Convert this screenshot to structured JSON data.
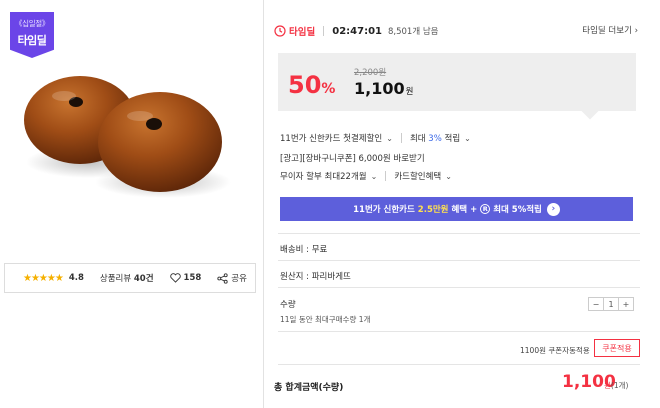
{
  "badge": {
    "top": "《십일절》",
    "main": "타임딜"
  },
  "rating": {
    "stars": "★★★★★",
    "score": "4.8",
    "review_label": "상품리뷰",
    "review_count": "40건",
    "likes": "158",
    "share_label": "공유"
  },
  "timedeal": {
    "label": "타임딜",
    "time": "02:47:01",
    "remaining": "8,501개 남음",
    "more": "타임딜 더보기"
  },
  "price": {
    "discount": "50",
    "pct": "%",
    "original": "2,200원",
    "sale": "1,100",
    "won": "원"
  },
  "benefits": {
    "card": "11번가 신한카드 첫결제할인",
    "max_prefix": "최대",
    "max_value": "3%",
    "max_suffix": "적립",
    "coupon": "[광고][장바구니쿠폰] 6,000원 바로받기",
    "installment": "무이자 할부 최대22개월",
    "card_discount": "카드할인혜택"
  },
  "banner": {
    "part1": "11번가 신한카드",
    "highlight": "2.5만원",
    "part2": "혜택 +",
    "r_mark": "R",
    "part3": "최대 5%적립",
    "arrow": "›"
  },
  "delivery": "배송비 : 무료",
  "origin": "원산지 : 파리바게뜨",
  "quantity": {
    "label": "수량",
    "sub": "11일 동안 최대구매수량 1개",
    "minus": "−",
    "value": "1",
    "plus": "+"
  },
  "coupon": {
    "text": "1100원 쿠폰자동적용",
    "button": "쿠폰적용"
  },
  "total": {
    "label": "총 합계금액(수량)",
    "price": "1,100",
    "won": "원",
    "unit": "(1개)"
  },
  "colors": {
    "accent_red": "#f43142",
    "purple": "#6b45e8",
    "banner": "#5d5fdb"
  },
  "icons": [
    "clock-icon",
    "heart-icon",
    "share-icon",
    "chevron-down-icon",
    "arrow-right-icon"
  ]
}
